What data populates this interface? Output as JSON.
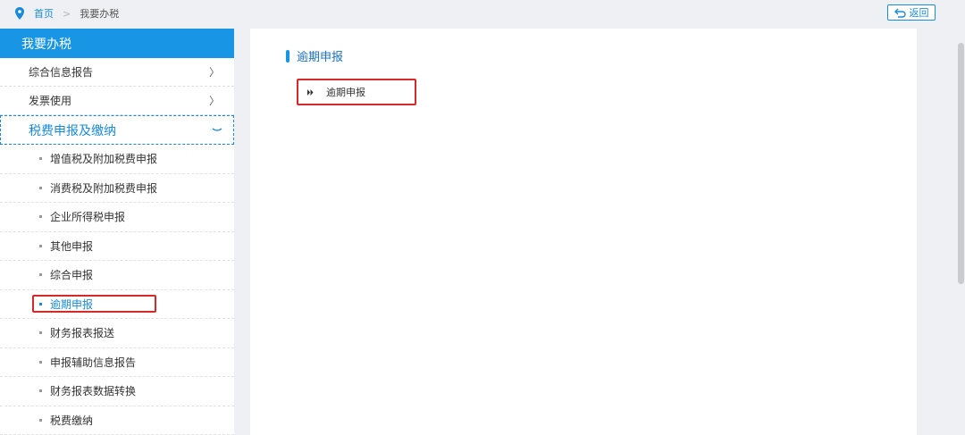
{
  "breadcrumb": {
    "home": "首页",
    "separator": ">",
    "current": "我要办税"
  },
  "back_button": {
    "label": "返回"
  },
  "sidebar": {
    "title": "我要办税",
    "items": [
      {
        "label": "综合信息报告",
        "chevron": "〉"
      },
      {
        "label": "发票使用",
        "chevron": "〉"
      }
    ],
    "group": {
      "label": "税费申报及缴纳",
      "subitems": [
        {
          "label": "增值税及附加税费申报"
        },
        {
          "label": "消费税及附加税费申报"
        },
        {
          "label": "企业所得税申报"
        },
        {
          "label": "其他申报"
        },
        {
          "label": "综合申报"
        },
        {
          "label": "逾期申报"
        },
        {
          "label": "财务报表报送"
        },
        {
          "label": "申报辅助信息报告"
        },
        {
          "label": "财务报表数据转换"
        },
        {
          "label": "税费缴纳"
        }
      ]
    }
  },
  "main": {
    "section_title": "逾期申报",
    "card_label": "逾期申报"
  },
  "colors": {
    "accent": "#1896e5",
    "highlight": "#d62a2a"
  },
  "icons": {
    "location": "map-pin-icon",
    "back": "return-arrow-icon",
    "card": "double-chevron-right-icon"
  }
}
